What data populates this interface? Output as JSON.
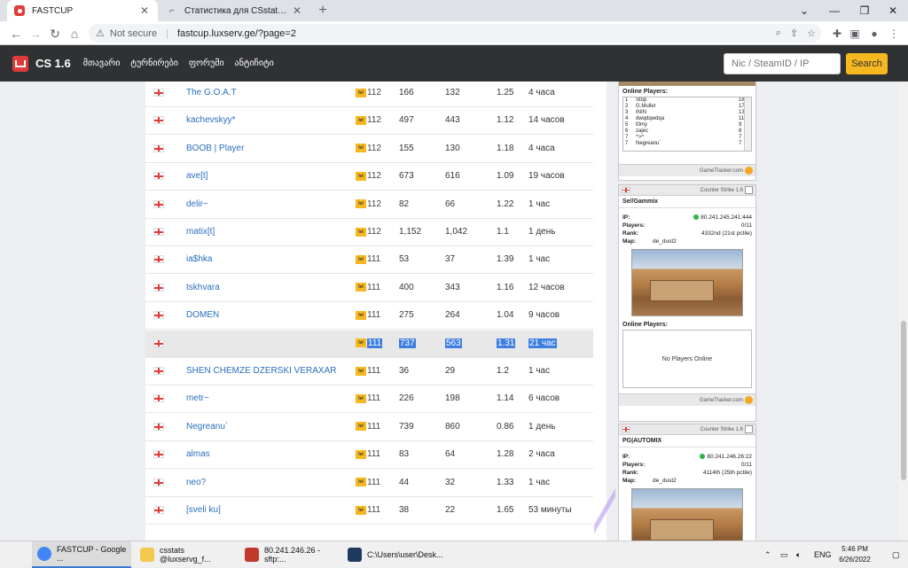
{
  "browser": {
    "tabs": [
      {
        "title": "FASTCUP",
        "active": true
      },
      {
        "title": "Статистика для CSstatsX SQL | D",
        "active": false
      }
    ],
    "address": {
      "security_label": "Not secure",
      "url": "fastcup.luxserv.ge/?page=2"
    },
    "window_controls": {
      "minimize": "—",
      "maximize": "❐",
      "close": "✕"
    }
  },
  "site": {
    "brand": "CS 1.6",
    "nav": [
      "მთავარი",
      "ტურნირები",
      "ფორუმი",
      "ანტიჩიტი"
    ],
    "search": {
      "placeholder": "Nic / SteamID / IP",
      "button": "Search"
    }
  },
  "leaderboard": {
    "rows": [
      {
        "name": "The G.O.A.T",
        "level": "112",
        "kills": "166",
        "deaths": "132",
        "kd": "1.25",
        "time": "4 часа"
      },
      {
        "name": "kachevskyy*",
        "level": "112",
        "kills": "497",
        "deaths": "443",
        "kd": "1.12",
        "time": "14 часов"
      },
      {
        "name": "BOOB | Player",
        "level": "112",
        "kills": "155",
        "deaths": "130",
        "kd": "1.18",
        "time": "4 часа"
      },
      {
        "name": "ave[t]",
        "level": "112",
        "kills": "673",
        "deaths": "616",
        "kd": "1.09",
        "time": "19 часов"
      },
      {
        "name": "delir~",
        "level": "112",
        "kills": "82",
        "deaths": "66",
        "kd": "1.22",
        "time": "1 час"
      },
      {
        "name": "matix[t]",
        "level": "112",
        "kills": "1,152",
        "deaths": "1,042",
        "kd": "1.1",
        "time": "1 день"
      },
      {
        "name": "ia$hka",
        "level": "111",
        "kills": "53",
        "deaths": "37",
        "kd": "1.39",
        "time": "1 час"
      },
      {
        "name": "tskhvara",
        "level": "111",
        "kills": "400",
        "deaths": "343",
        "kd": "1.16",
        "time": "12 часов"
      },
      {
        "name": "DOMEN",
        "level": "111",
        "kills": "275",
        "deaths": "264",
        "kd": "1.04",
        "time": "9 часов"
      },
      {
        "name": "",
        "level": "111",
        "kills": "737",
        "deaths": "563",
        "kd": "1.31",
        "time": "21 час",
        "highlighted": true
      },
      {
        "name": "SHEN CHEMZE DZERSKI VERAXAR",
        "level": "111",
        "kills": "36",
        "deaths": "29",
        "kd": "1.2",
        "time": "1 час"
      },
      {
        "name": "metr~",
        "level": "111",
        "kills": "226",
        "deaths": "198",
        "kd": "1.14",
        "time": "6 часов"
      },
      {
        "name": "Negreanu`",
        "level": "111",
        "kills": "739",
        "deaths": "860",
        "kd": "0.86",
        "time": "1 день"
      },
      {
        "name": "almas",
        "level": "111",
        "kills": "83",
        "deaths": "64",
        "kd": "1.28",
        "time": "2 часа"
      },
      {
        "name": "neo?",
        "level": "111",
        "kills": "44",
        "deaths": "32",
        "kd": "1.33",
        "time": "1 час"
      },
      {
        "name": "[sveli ku]",
        "level": "111",
        "kills": "38",
        "deaths": "22",
        "kd": "1.65",
        "time": "53 минуты"
      }
    ]
  },
  "widgets": {
    "top": {
      "online_players_label": "Online Players:",
      "players": [
        {
          "rank": "1",
          "name": "Stop",
          "score": "18"
        },
        {
          "rank": "2",
          "name": "G.Muller",
          "score": "17"
        },
        {
          "rank": "3",
          "name": "ININ",
          "score": "13"
        },
        {
          "rank": "4",
          "name": "dwqdqwdqa",
          "score": "11"
        },
        {
          "rank": "5",
          "name": "t0my",
          "score": "9"
        },
        {
          "rank": "6",
          "name": "zajec",
          "score": "8"
        },
        {
          "rank": "7",
          "name": "^>^",
          "score": "7"
        },
        {
          "rank": "7",
          "name": "Negreanu`",
          "score": "7"
        }
      ],
      "footer": "GameTracker.com"
    },
    "servers": [
      {
        "game": "Counter Strike 1.6",
        "name": "Se//Gammix",
        "ip_label": "IP:",
        "ip": "80.241.245.241:444",
        "players_label": "Players:",
        "players": "0/11",
        "rank_label": "Rank:",
        "rank": "4332nd (21st pctile)",
        "map_label": "Map:",
        "map": "de_dust2",
        "online_players_label": "Online Players:",
        "no_players": "No Players Online",
        "footer": "GameTracker.com"
      },
      {
        "game": "Counter Strike 1.6",
        "name": "PG|AUTOMIX",
        "ip_label": "IP:",
        "ip": "80.241.246.26:22",
        "players_label": "Players:",
        "players": "0/11",
        "rank_label": "Rank:",
        "rank": "4114th (25th pctile)",
        "map_label": "Map:",
        "map": "de_dust2"
      }
    ]
  },
  "taskbar": {
    "items": [
      {
        "label": "FASTCUP - Google ...",
        "color": "#4285f4"
      },
      {
        "label": "csstats @luxservg_f...",
        "color": "#f2c94c"
      },
      {
        "label": "80.241.246.26 - sftp:...",
        "color": "#c0392b"
      },
      {
        "label": "C:\\Users\\user\\Desk...",
        "color": "#1f3a5f"
      }
    ],
    "lang": "ENG",
    "time": "5:46 PM",
    "date": "6/26/2022"
  }
}
